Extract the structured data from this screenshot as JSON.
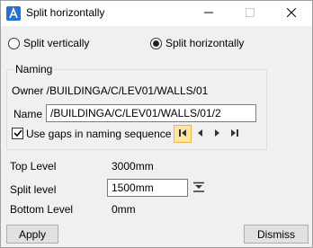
{
  "window": {
    "title": "Split horizontally",
    "icons": {
      "app": "app-logo-icon",
      "minimize": "minimize-icon",
      "maximize": "maximize-icon",
      "close": "close-icon"
    }
  },
  "split_mode": {
    "options": [
      {
        "label": "Split vertically",
        "selected": false
      },
      {
        "label": "Split horizontally",
        "selected": true
      }
    ]
  },
  "naming": {
    "legend": "Naming",
    "owner_text": "Owner /BUILDINGA/C/LEV01/WALLS/01",
    "name_label": "Name",
    "name_value": "/BUILDINGA/C/LEV01/WALLS/01/2",
    "gaps_label": "Use gaps in naming sequence",
    "gaps_checked": true,
    "nav_icons": [
      "first-icon",
      "previous-icon",
      "next-icon",
      "last-icon"
    ]
  },
  "levels": {
    "top_label": "Top Level",
    "top_value": "3000mm",
    "split_label": "Split level",
    "split_value": "1500mm",
    "split_pick_icon": "pick-level-icon",
    "bottom_label": "Bottom Level",
    "bottom_value": "0mm"
  },
  "buttons": {
    "apply": "Apply",
    "dismiss": "Dismiss"
  }
}
